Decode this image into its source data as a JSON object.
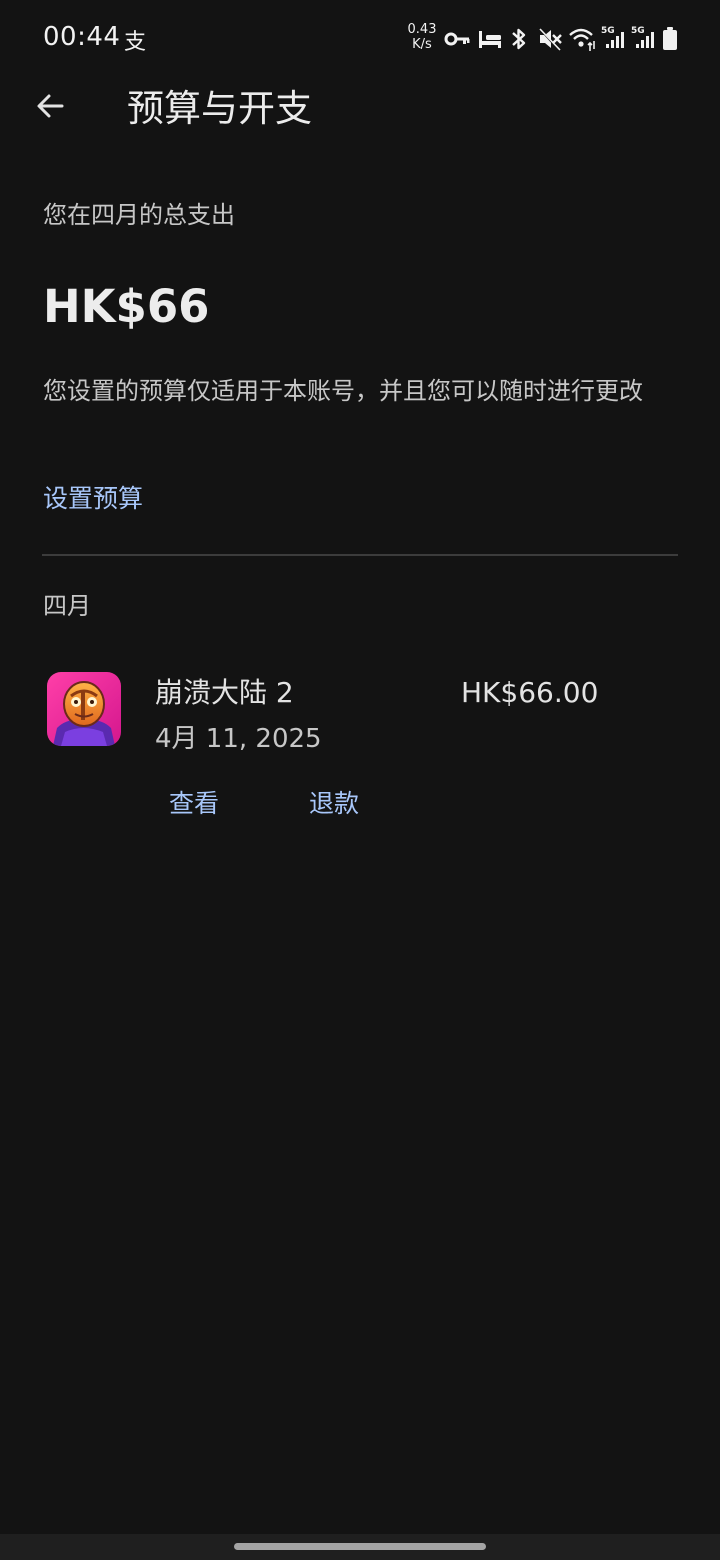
{
  "status_bar": {
    "time": "00:44",
    "alipay_glyph": "支",
    "net_speed_value": "0.43",
    "net_speed_unit": "K/s",
    "icons": [
      "key-icon",
      "bed-icon",
      "bluetooth-icon",
      "mute-icon",
      "wifi-icon",
      "signal-5g-icon",
      "signal-5g-icon",
      "battery-icon"
    ],
    "signal_labels": [
      "5G",
      "5G"
    ]
  },
  "app_bar": {
    "back_icon": "arrow-back-icon",
    "title": "预算与开支"
  },
  "summary": {
    "label": "您在四月的总支出",
    "total": "HK$66",
    "note": "您设置的预算仅适用于本账号，并且您可以随时进行更改",
    "set_budget_label": "设置预算"
  },
  "month_section": {
    "header": "四月",
    "transactions": [
      {
        "app_name": "崩溃大陆 2",
        "date": "4月 11, 2025",
        "price": "HK$66.00",
        "view_label": "查看",
        "refund_label": "退款"
      }
    ]
  },
  "colors": {
    "background": "#131313",
    "accent_link": "#a8c7fa",
    "divider": "#3c3c3c"
  }
}
